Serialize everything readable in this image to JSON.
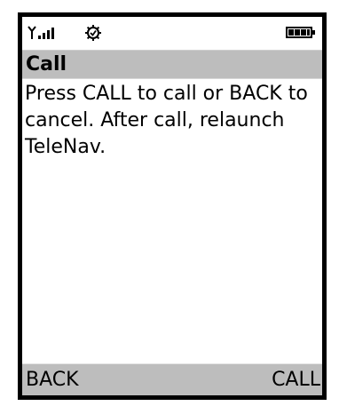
{
  "status_bar": {
    "signal_icon": "signal-strength-icon",
    "settings_icon": "settings-gear-icon",
    "battery_icon": "battery-icon"
  },
  "title_bar": {
    "title": "Call",
    "background_color": "#bdbdbd"
  },
  "content": {
    "message": "Press CALL to call or BACK to cancel. After call, relaunch TeleNav."
  },
  "softkeys": {
    "left_label": "BACK",
    "right_label": "CALL",
    "background_color": "#bdbdbd"
  }
}
